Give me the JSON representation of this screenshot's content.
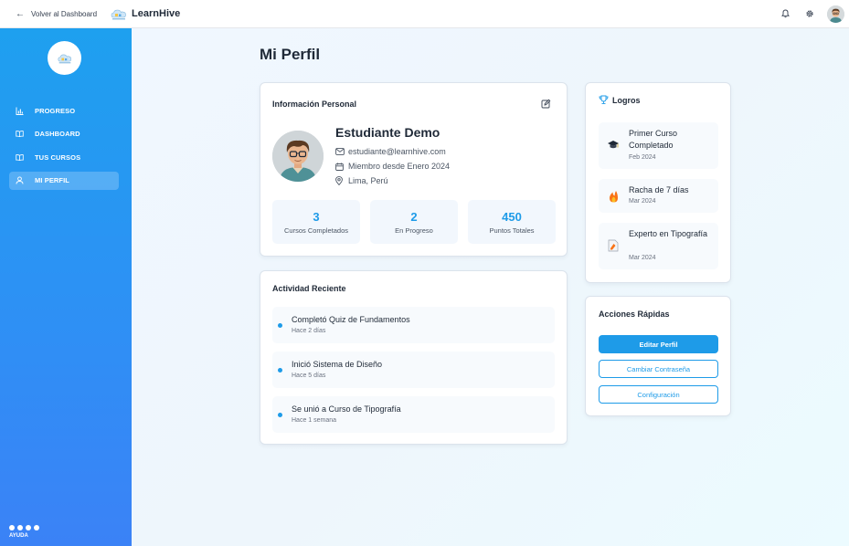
{
  "topbar": {
    "back_label": "Volver al Dashboard",
    "brand_name": "LearnHive",
    "icons": [
      "bell-icon",
      "gear-icon",
      "user-avatar"
    ]
  },
  "sidebar": {
    "items": [
      {
        "label": "PROGRESO",
        "icon": "bar-chart-icon"
      },
      {
        "label": "DASHBOARD",
        "icon": "book-icon"
      },
      {
        "label": "TUS CURSOS",
        "icon": "book-icon"
      },
      {
        "label": "MI PERFIL",
        "icon": "user-icon",
        "active": true
      }
    ],
    "help_label": "AYUDA"
  },
  "page": {
    "title": "Mi Perfil"
  },
  "personal_info": {
    "title": "Información Personal",
    "name": "Estudiante Demo",
    "email": "estudiante@learnhive.com",
    "member_since": "Miembro desde Enero 2024",
    "location": "Lima, Perú",
    "stats": [
      {
        "value": "3",
        "label": "Cursos Completados"
      },
      {
        "value": "2",
        "label": "En Progreso"
      },
      {
        "value": "450",
        "label": "Puntos Totales"
      }
    ]
  },
  "activity": {
    "title": "Actividad Reciente",
    "items": [
      {
        "text": "Completó Quiz de Fundamentos",
        "time": "Hace 2 días"
      },
      {
        "text": "Inició Sistema de Diseño",
        "time": "Hace 5 días"
      },
      {
        "text": "Se unió a Curso de Tipografía",
        "time": "Hace 1 semana"
      }
    ]
  },
  "achievements": {
    "title": "Logros",
    "items": [
      {
        "name": "Primer Curso Completado",
        "date": "Feb 2024",
        "icon": "graduation-cap-icon"
      },
      {
        "name": "Racha de 7 días",
        "date": "Mar 2024",
        "icon": "fire-icon"
      },
      {
        "name": "Experto en Tipografía",
        "date": "Mar 2024",
        "icon": "document-icon"
      }
    ]
  },
  "quick_actions": {
    "title": "Acciones Rápidas",
    "edit_profile": "Editar Perfil",
    "change_password": "Cambiar Contraseña",
    "settings": "Configuración"
  },
  "colors": {
    "accent": "#1e9be8",
    "sidebar_top": "#1ea0ef",
    "sidebar_bottom": "#3b82f6",
    "text": "#1f2937"
  }
}
